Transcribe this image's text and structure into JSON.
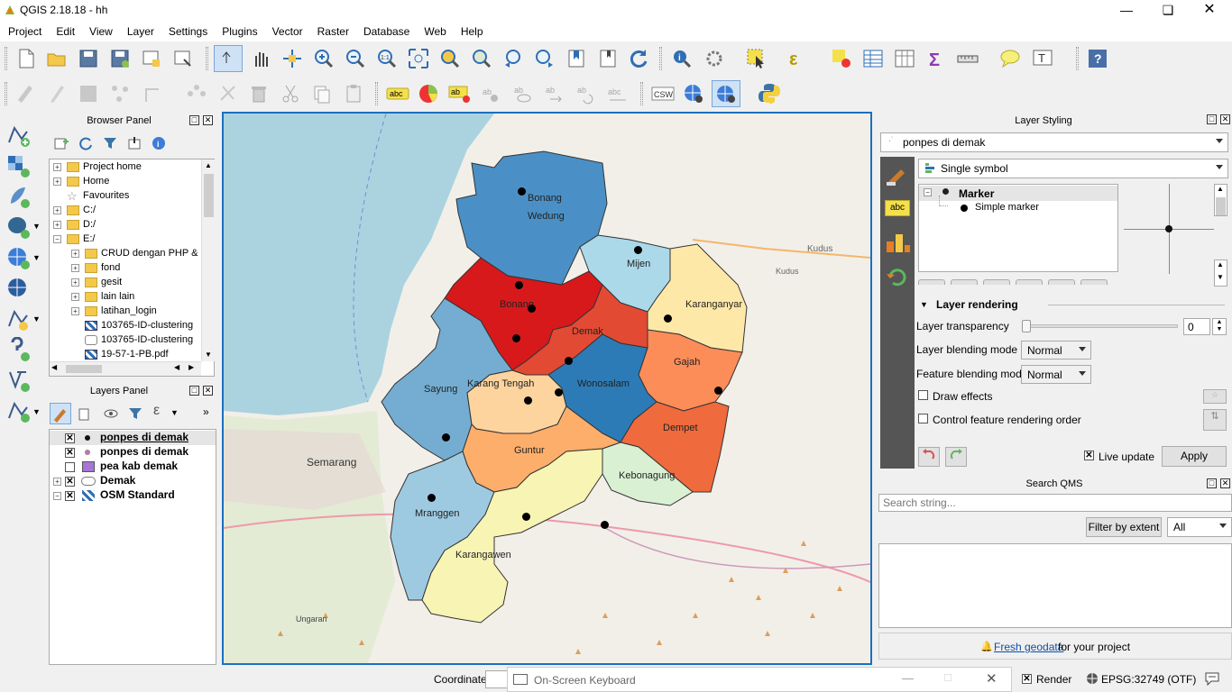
{
  "app": {
    "title": "QGIS 2.18.18 - hh"
  },
  "menu": [
    "Project",
    "Edit",
    "View",
    "Layer",
    "Settings",
    "Plugins",
    "Vector",
    "Raster",
    "Database",
    "Web",
    "Help"
  ],
  "browser_panel": {
    "title": "Browser Panel",
    "items": [
      {
        "label": "Project home",
        "indent": 0,
        "expander": "+"
      },
      {
        "label": "Home",
        "indent": 0,
        "expander": "+"
      },
      {
        "label": "Favourites",
        "indent": 0,
        "expander": ""
      },
      {
        "label": "C:/",
        "indent": 0,
        "expander": "+"
      },
      {
        "label": "D:/",
        "indent": 0,
        "expander": "+"
      },
      {
        "label": "E:/",
        "indent": 0,
        "expander": "-"
      },
      {
        "label": "CRUD dengan PHP &",
        "indent": 1,
        "expander": "+"
      },
      {
        "label": "fond",
        "indent": 1,
        "expander": "+"
      },
      {
        "label": "gesit",
        "indent": 1,
        "expander": "+"
      },
      {
        "label": "lain lain",
        "indent": 1,
        "expander": "+"
      },
      {
        "label": "latihan_login",
        "indent": 1,
        "expander": "+"
      },
      {
        "label": "103765-ID-clustering",
        "indent": 1,
        "expander": "",
        "icon": "raster"
      },
      {
        "label": "103765-ID-clustering",
        "indent": 1,
        "expander": "",
        "icon": "vector"
      },
      {
        "label": "19-57-1-PB.pdf",
        "indent": 1,
        "expander": "",
        "icon": "raster"
      }
    ]
  },
  "layers_panel": {
    "title": "Layers Panel",
    "layers": [
      {
        "label": "ponpes di demak",
        "checked": true,
        "symbol": "black-dot",
        "selected": true
      },
      {
        "label": "ponpes di demak",
        "checked": true,
        "symbol": "pink-dot",
        "selected": false
      },
      {
        "label": "pea kab demak",
        "checked": false,
        "symbol": "purple-square",
        "selected": false
      },
      {
        "label": "Demak",
        "checked": true,
        "symbol": "polygon",
        "selected": false,
        "expander": "+"
      },
      {
        "label": "OSM Standard",
        "checked": true,
        "symbol": "raster",
        "selected": false,
        "expander": "-"
      }
    ]
  },
  "map": {
    "regions": [
      "Bonang",
      "Wedung",
      "Mijen",
      "Bonang",
      "Karanganyar",
      "Demak",
      "Gajah",
      "Sayung",
      "Karang Tengah",
      "Wonosalam",
      "Dempet",
      "Guntur",
      "Kebonagung",
      "Mranggen",
      "Karangawen"
    ],
    "basemap_labels": [
      "Kudus",
      "Kudus",
      "Semarang",
      "Ungaran"
    ]
  },
  "layer_styling": {
    "title": "Layer Styling",
    "layer_select": "ponpes di demak",
    "renderer": "Single symbol",
    "symbol_tree": [
      "Marker",
      "Simple marker"
    ],
    "section": "Layer rendering",
    "transparency_label": "Layer transparency",
    "transparency_value": "0",
    "blending_label": "Layer blending mode",
    "blending_value": "Normal",
    "feature_blending_label": "Feature blending mode",
    "feature_blending_value": "Normal",
    "draw_effects": "Draw effects",
    "control_order": "Control feature rendering order",
    "live_update": "Live update",
    "apply": "Apply"
  },
  "search_qms": {
    "title": "Search QMS",
    "placeholder": "Search string...",
    "filter_btn": "Filter by extent",
    "filter_select": "All",
    "footer_link": "Fresh geodata",
    "footer_text": " for your project"
  },
  "statusbar": {
    "coordinate_label": "Coordinate",
    "render_label": "Render",
    "crs": "EPSG:32749 (OTF)"
  },
  "osk": {
    "title": "On-Screen Keyboard"
  },
  "colors": {
    "accent": "#1c6fbf",
    "dark_red": "#d7191c",
    "red_orange": "#e34a33",
    "orange": "#fc8d59",
    "light_orange": "#fdbb84",
    "pale_yellow": "#fee8a8",
    "light_blue": "#abd9e9",
    "mid_blue": "#74add1",
    "blue": "#4575b4",
    "dark_blue": "#2c7bb6"
  }
}
